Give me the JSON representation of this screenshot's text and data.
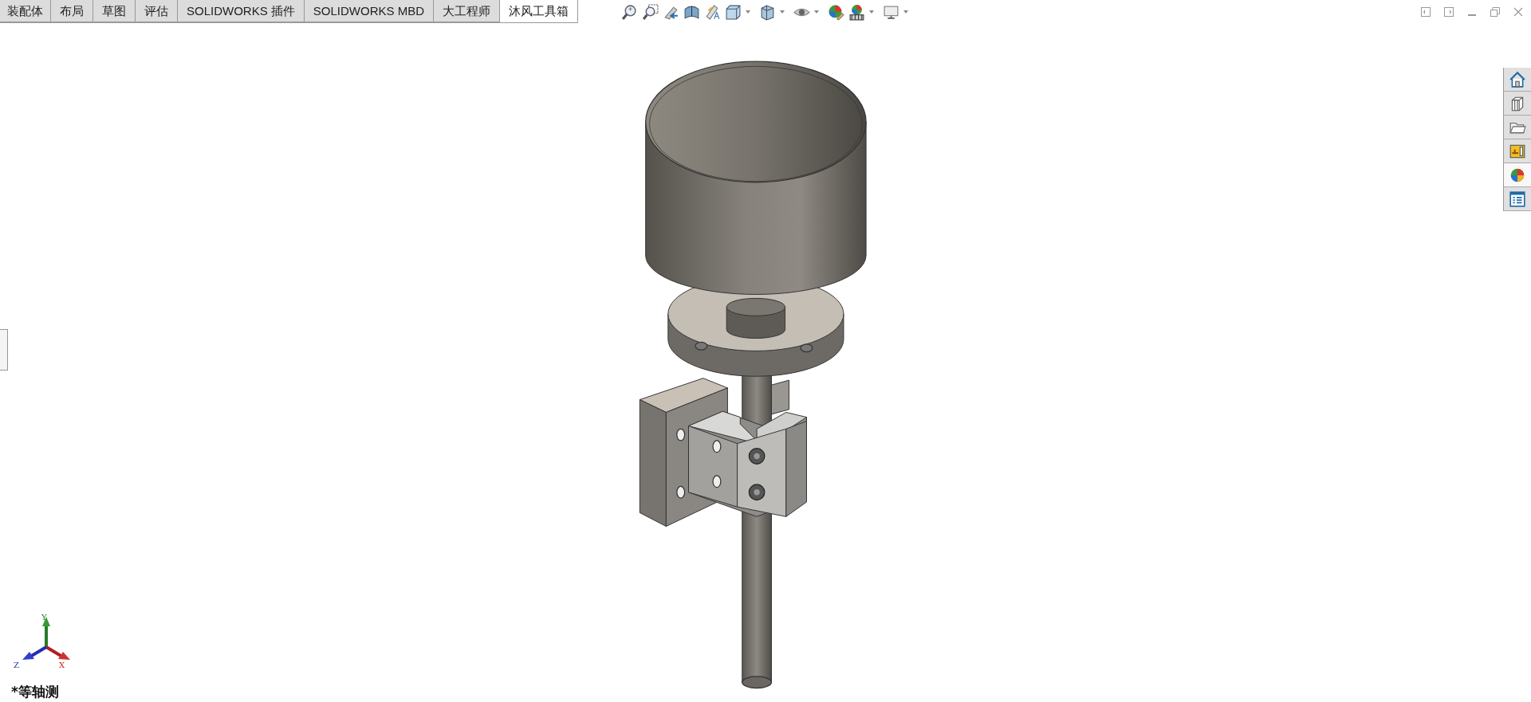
{
  "tabs": [
    {
      "label": "装配体",
      "selected": false
    },
    {
      "label": "布局",
      "selected": false
    },
    {
      "label": "草图",
      "selected": false
    },
    {
      "label": "评估",
      "selected": false
    },
    {
      "label": "SOLIDWORKS 插件",
      "selected": false
    },
    {
      "label": "SOLIDWORKS MBD",
      "selected": false
    },
    {
      "label": "大工程师",
      "selected": false
    },
    {
      "label": "沐风工具箱",
      "selected": true
    }
  ],
  "triad": {
    "x_label": "X",
    "y_label": "Y",
    "z_label": "Z"
  },
  "view_name": "*等轴测"
}
